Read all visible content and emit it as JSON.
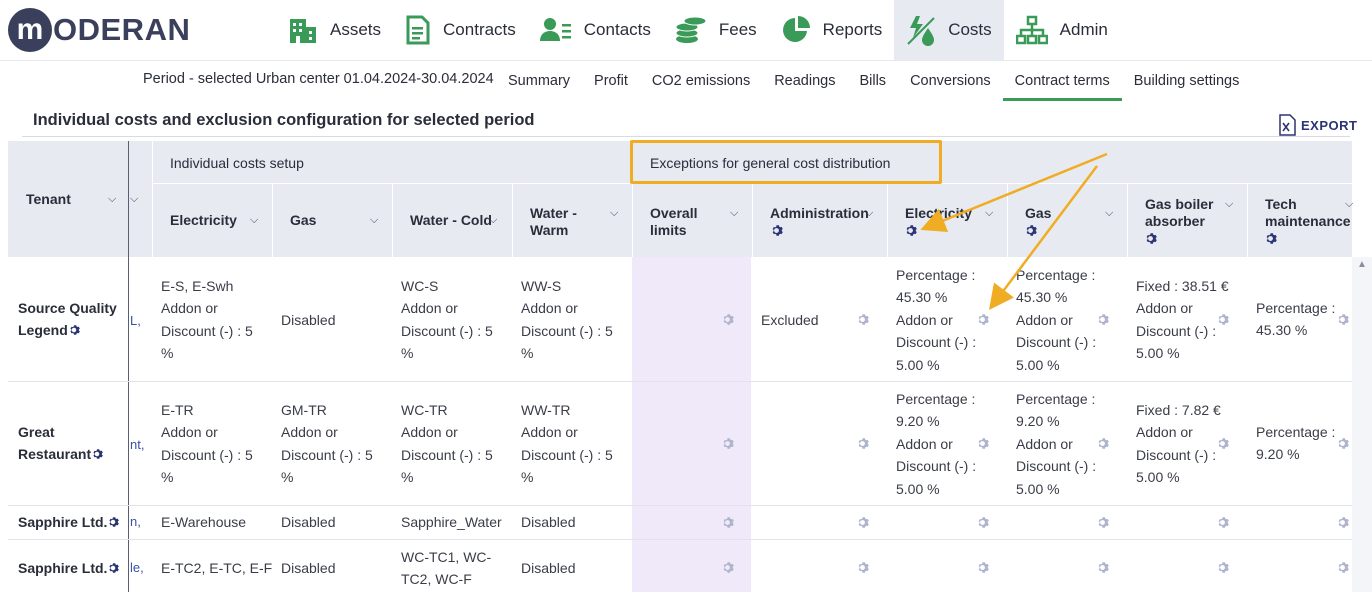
{
  "brand": {
    "logo_letter": "m",
    "logo_text": "ODERAN"
  },
  "nav": [
    {
      "label": "Assets",
      "icon": "building-icon"
    },
    {
      "label": "Contracts",
      "icon": "document-icon"
    },
    {
      "label": "Contacts",
      "icon": "contact-icon"
    },
    {
      "label": "Fees",
      "icon": "coins-icon"
    },
    {
      "label": "Reports",
      "icon": "pie-chart-icon"
    },
    {
      "label": "Costs",
      "icon": "costs-icon",
      "active": true
    },
    {
      "label": "Admin",
      "icon": "org-chart-icon"
    }
  ],
  "subnav": {
    "period": "Period - selected Urban center 01.04.2024-30.04.2024",
    "tabs": [
      "Summary",
      "Profit",
      "CO2 emissions",
      "Readings",
      "Bills",
      "Conversions",
      "Contract terms",
      "Building settings"
    ],
    "active_tab": "Contract terms"
  },
  "page": {
    "title": "Individual costs and exclusion configuration for selected period",
    "export_label": "EXPORT"
  },
  "table": {
    "group_individual": "Individual costs setup",
    "group_exceptions": "Exceptions for general cost distribution",
    "col_tenant": "Tenant",
    "col_electricity": "Electricity",
    "col_gas": "Gas",
    "col_water_cold": "Water - Cold",
    "col_water_warm_1": "Water -",
    "col_water_warm_2": "Warm",
    "col_overall_1": "Overall",
    "col_overall_2": "limits",
    "col_administration": "Administration",
    "col_ex_electricity": "Electricity",
    "col_ex_gas": "Gas",
    "col_gas_boiler_1": "Gas boiler",
    "col_gas_boiler_2": "absorber",
    "col_tech_1": "Tech",
    "col_tech_2": "maintenance",
    "rows": [
      {
        "tenant_1": "Source Quality",
        "tenant_2": "Legend",
        "link": "L,",
        "electricity": [
          "E-S, E-Swh",
          "Addon or",
          "Discount (-) : 5",
          "%"
        ],
        "gas": "Disabled",
        "water_cold": [
          "WC-S",
          "Addon or",
          "Discount (-) : 5",
          "%"
        ],
        "water_warm": [
          "WW-S",
          "Addon or",
          "Discount (-) : 5",
          "%"
        ],
        "administration": "Excluded",
        "ex_electricity": [
          "Percentage :",
          "45.30 %",
          "Addon or",
          "Discount (-) :",
          "5.00 %"
        ],
        "ex_gas": [
          "Percentage :",
          "45.30 %",
          "Addon or",
          "Discount (-) :",
          "5.00 %"
        ],
        "gas_boiler": [
          "Fixed : 38.51 €",
          "Addon or",
          "Discount (-) :",
          "5.00 %"
        ],
        "tech": [
          "Percentage :",
          "45.30 %"
        ]
      },
      {
        "tenant_1": "Great",
        "tenant_2": "Restaurant",
        "link": "nt,",
        "electricity": [
          "E-TR",
          "Addon or",
          "Discount (-) : 5",
          "%"
        ],
        "gas": [
          "GM-TR",
          "Addon or",
          "Discount (-) : 5",
          "%"
        ],
        "water_cold": [
          "WC-TR",
          "Addon or",
          "Discount (-) : 5",
          "%"
        ],
        "water_warm": [
          "WW-TR",
          "Addon or",
          "Discount (-) : 5",
          "%"
        ],
        "ex_electricity": [
          "Percentage :",
          "9.20 %",
          "Addon or",
          "Discount (-) :",
          "5.00 %"
        ],
        "ex_gas": [
          "Percentage :",
          "9.20 %",
          "Addon or",
          "Discount (-) :",
          "5.00 %"
        ],
        "gas_boiler": [
          "Fixed : 7.82 €",
          "Addon or",
          "Discount (-) :",
          "5.00 %"
        ],
        "tech": [
          "Percentage :",
          "9.20 %"
        ]
      },
      {
        "tenant_1": "Sapphire Ltd.",
        "link": "n,",
        "electricity": "E-Warehouse",
        "gas": "Disabled",
        "water_cold": "Sapphire_Water",
        "water_warm": "Disabled"
      },
      {
        "tenant_1": "Sapphire Ltd.",
        "link": "le,",
        "electricity": "E-TC2, E-TC, E-F",
        "gas": "Disabled",
        "water_cold": [
          "WC-TC1, WC-",
          "TC2, WC-F"
        ],
        "water_warm": "Disabled"
      }
    ]
  },
  "colors": {
    "accent": "#3a9a58",
    "highlight": "#f0ac22",
    "header_bg": "#e8eaf1",
    "brand": "#3a3f5c"
  }
}
